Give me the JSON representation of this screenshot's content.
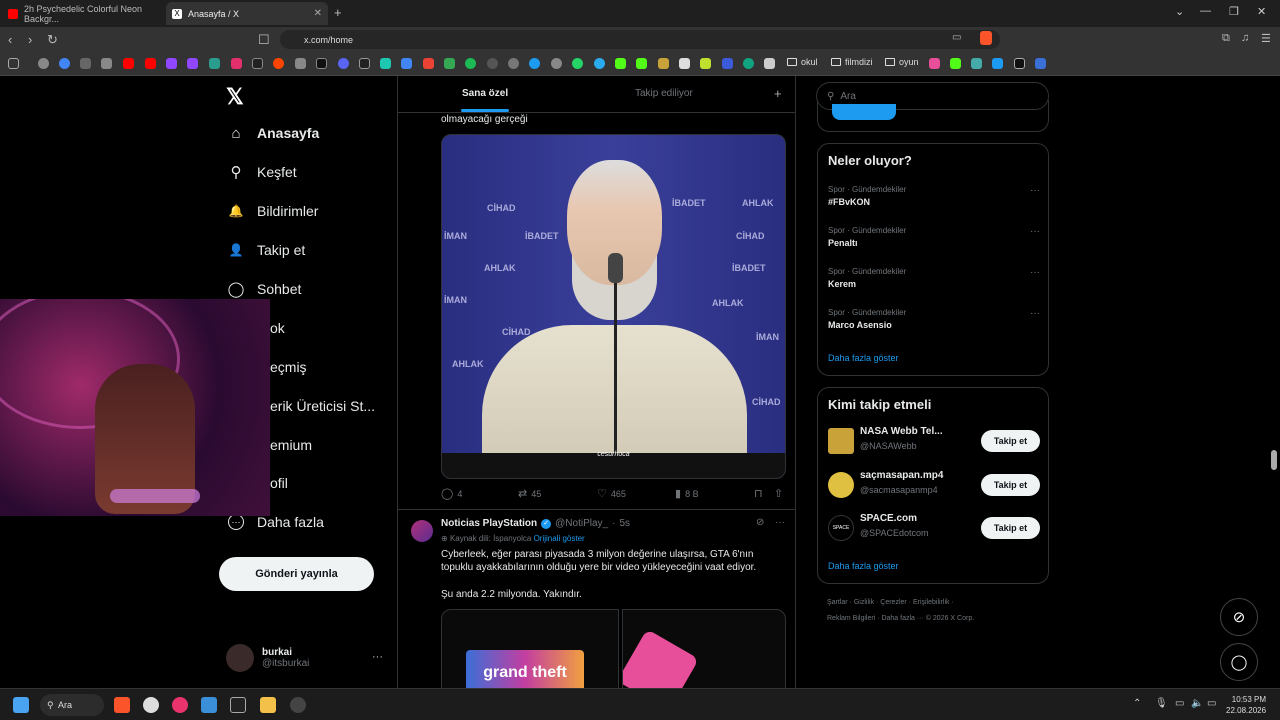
{
  "browser": {
    "tabs": [
      {
        "title": "2h Psychedelic Colorful Neon Backgr...",
        "icon": "youtube-icon",
        "color": "#ff0000"
      },
      {
        "title": "Anasayfa / X",
        "icon": "x-icon",
        "color": "#ffffff"
      }
    ],
    "url": "x.com/home",
    "bookmark_folders": [
      "okul",
      "filmdizi",
      "oyun"
    ]
  },
  "x": {
    "logo": "𝕏",
    "nav": [
      {
        "label": "Anasayfa",
        "icon": "home-icon",
        "glyph": "⌂"
      },
      {
        "label": "Keşfet",
        "icon": "search-icon",
        "glyph": "⚲"
      },
      {
        "label": "Bildirimler",
        "icon": "bell-icon",
        "glyph": "🔔"
      },
      {
        "label": "Takip et",
        "icon": "add-user-icon",
        "glyph": "👤"
      },
      {
        "label": "Sohbet",
        "icon": "chat-icon",
        "glyph": "◯"
      },
      {
        "label": "Grok",
        "visible": "ok",
        "icon": "grok-icon",
        "glyph": ""
      },
      {
        "label": "Geçmiş",
        "visible": "eçmiş",
        "icon": "history-icon",
        "glyph": ""
      },
      {
        "label": "İçerik Üreticisi St...",
        "visible": "erik Üreticisi St...",
        "icon": "creator-icon",
        "glyph": ""
      },
      {
        "label": "Premium",
        "visible": "emium",
        "icon": "premium-icon",
        "glyph": ""
      },
      {
        "label": "Profil",
        "visible": "ofil",
        "icon": "profile-icon",
        "glyph": ""
      },
      {
        "label": "Daha fazla",
        "icon": "more-icon",
        "glyph": "⋯"
      }
    ],
    "post_button": "Gönderi yayınla",
    "profile": {
      "name": "burkai",
      "handle": "@itsburkai"
    },
    "tabs": {
      "for_you": "Sana özel",
      "following": "Takip ediliyor"
    },
    "tweet1": {
      "text_tail": "olmayacağı gerçeği",
      "video_watermark": "cesurhoca",
      "backdrop_words": [
        "CİHAD",
        "İBADET",
        "AHLAK",
        "İMAN",
        "İBADET",
        "AHLAK",
        "CİHAD",
        "İMAN",
        "İBADET",
        "AHLAK",
        "CİHAD",
        "İMAN",
        "AHLAK",
        "CİHAD"
      ],
      "replies": "4",
      "reposts": "45",
      "likes": "465",
      "views": "8 B"
    },
    "tweet2": {
      "author": "Noticias PlayStation",
      "handle": "@NotiPlay_",
      "time": "5s",
      "source_lang": "Kaynak dili: İspanyolca",
      "show_original": "Orijinali göster",
      "text1": "Cyberleek, eğer parası piyasada 3 milyon değerine ulaşırsa, GTA 6'nın topuklu ayakkabılarının olduğu yere bir video yükleyeceğini vaat ediyor.",
      "text2": "Şu anda 2.2 milyonda. Yakındır.",
      "image_text": "grand theft"
    },
    "search_placeholder": "Ara",
    "trends": {
      "title": "Neler oluyor?",
      "items": [
        {
          "category": "Spor · Gündemdekiler",
          "name": "#FBvKON"
        },
        {
          "category": "Spor · Gündemdekiler",
          "name": "Penaltı"
        },
        {
          "category": "Spor · Gündemdekiler",
          "name": "Kerem"
        },
        {
          "category": "Spor · Gündemdekiler",
          "name": "Marco Asensio"
        }
      ],
      "more": "Daha fazla göster"
    },
    "who_to_follow": {
      "title": "Kimi takip etmeli",
      "items": [
        {
          "name": "NASA Webb Tel...",
          "handle": "@NASAWebb",
          "button": "Takip et",
          "color": "#c9a23a"
        },
        {
          "name": "saçmasapan.mp4",
          "handle": "@sacmasapanmp4",
          "button": "Takip et",
          "color": "#e0c040"
        },
        {
          "name": "SPACE.com",
          "handle": "@SPACEdotcom",
          "button": "Takip et",
          "color": "#000000"
        }
      ],
      "more": "Daha fazla göster"
    },
    "footer": {
      "line1": "Şartlar  ·  Gizlilik  ·  Çerezler  ·  Erişilebilirlik  ·",
      "line2": "Reklam Bilgileri  ·  Daha fazla ···  © 2026 X Corp."
    }
  },
  "taskbar": {
    "search": "Ara",
    "time": "10:53 PM",
    "date": "22.08.2026"
  },
  "colors": {
    "accent": "#1d9bf0",
    "background": "#000000",
    "border": "#2f3336"
  }
}
